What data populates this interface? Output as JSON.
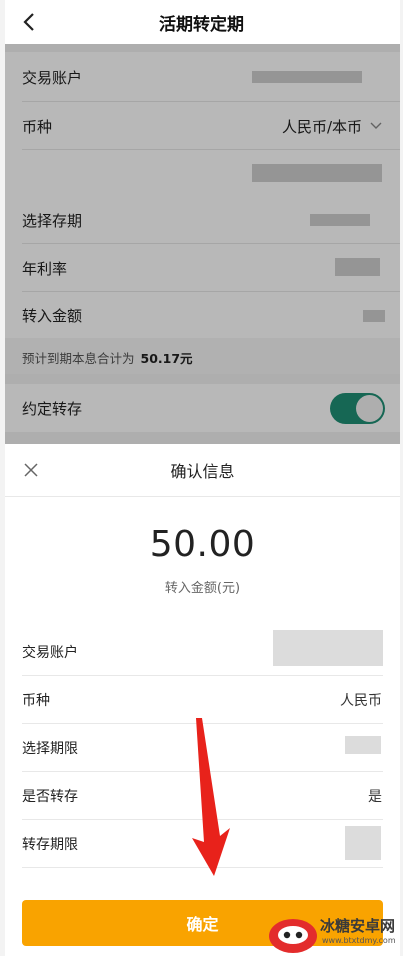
{
  "header": {
    "title": "活期转定期"
  },
  "background_form": {
    "rows": [
      {
        "label": "交易账户",
        "value": ""
      },
      {
        "label": "币种",
        "value": "人民币/本币"
      },
      {
        "label": "",
        "value": ""
      },
      {
        "label": "选择存期",
        "value": ""
      },
      {
        "label": "年利率",
        "value": ""
      },
      {
        "label": "转入金额",
        "value": ""
      }
    ],
    "estimate_label": "预计到期本息合计为",
    "estimate_value": "50.17元",
    "auto_renew_label": "约定转存",
    "auto_renew_on": true
  },
  "sheet": {
    "title": "确认信息",
    "amount": "50.00",
    "amount_caption": "转入金额(元)",
    "rows": [
      {
        "label": "交易账户",
        "value": ""
      },
      {
        "label": "币种",
        "value": "人民币"
      },
      {
        "label": "选择期限",
        "value": ""
      },
      {
        "label": "是否转存",
        "value": "是"
      },
      {
        "label": "转存期限",
        "value": ""
      }
    ],
    "confirm_label": "确定"
  },
  "watermark": {
    "name": "冰糖安卓网",
    "site": "www.btxtdmy.com"
  },
  "colors": {
    "accent": "#f9a300",
    "toggle_on": "#1f8f75",
    "arrow": "#e8221b"
  }
}
